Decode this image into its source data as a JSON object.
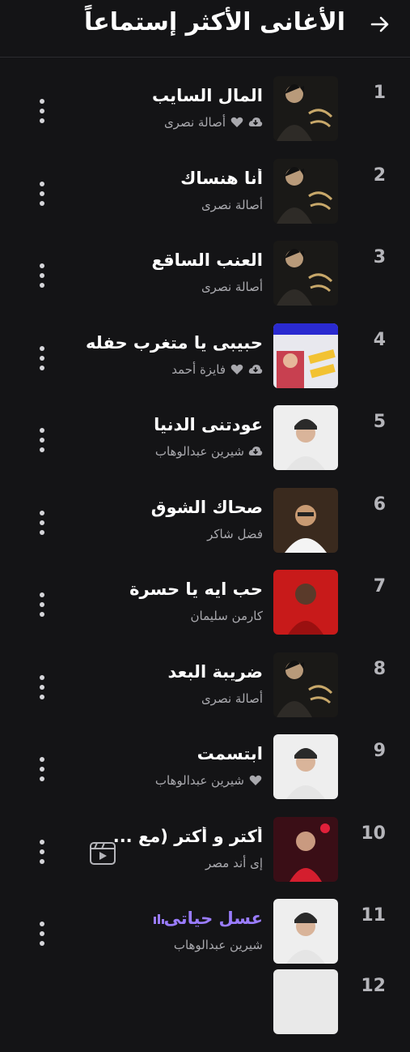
{
  "header": {
    "title": "الأغانى الأكثر إستماعاً",
    "back_icon": "arrow-right-icon"
  },
  "colors": {
    "background": "#141416",
    "accent": "#9a7cff",
    "secondary_text": "#a9a9ae"
  },
  "songs": [
    {
      "rank": "1",
      "title": "المال السايب",
      "artist": "أصالة نصرى",
      "downloaded": true,
      "liked": true,
      "playing": false,
      "video": false
    },
    {
      "rank": "2",
      "title": "أنا هنساك",
      "artist": "أصالة نصرى",
      "downloaded": false,
      "liked": false,
      "playing": false,
      "video": false
    },
    {
      "rank": "3",
      "title": "العنب الساقع",
      "artist": "أصالة نصرى",
      "downloaded": false,
      "liked": false,
      "playing": false,
      "video": false
    },
    {
      "rank": "4",
      "title": "حبيبى يا متغرب حفله",
      "artist": "فايزة أحمد",
      "downloaded": true,
      "liked": true,
      "playing": false,
      "video": false
    },
    {
      "rank": "5",
      "title": "عودتنى الدنيا",
      "artist": "شيرين عبدالوهاب",
      "downloaded": true,
      "liked": false,
      "playing": false,
      "video": false
    },
    {
      "rank": "6",
      "title": "صحاك الشوق",
      "artist": "فضل شاكر",
      "downloaded": false,
      "liked": false,
      "playing": false,
      "video": false
    },
    {
      "rank": "7",
      "title": "حب ايه يا حسرة",
      "artist": "كارمن سليمان",
      "downloaded": false,
      "liked": false,
      "playing": false,
      "video": false
    },
    {
      "rank": "8",
      "title": "ضريبة البعد",
      "artist": "أصالة نصرى",
      "downloaded": false,
      "liked": false,
      "playing": false,
      "video": false
    },
    {
      "rank": "9",
      "title": "ابتسمت",
      "artist": "شيرين عبدالوهاب",
      "downloaded": false,
      "liked": true,
      "playing": false,
      "video": false
    },
    {
      "rank": "10",
      "title": "أكتر و أكتر (مع ...",
      "artist": "إى أند مصر",
      "downloaded": false,
      "liked": false,
      "playing": false,
      "video": true
    },
    {
      "rank": "11",
      "title": "عسل حياتى",
      "artist": "شيرين عبدالوهاب",
      "downloaded": false,
      "liked": false,
      "playing": true,
      "video": false
    },
    {
      "rank": "12",
      "title": "",
      "artist": "",
      "downloaded": false,
      "liked": false,
      "playing": false,
      "video": false
    }
  ]
}
